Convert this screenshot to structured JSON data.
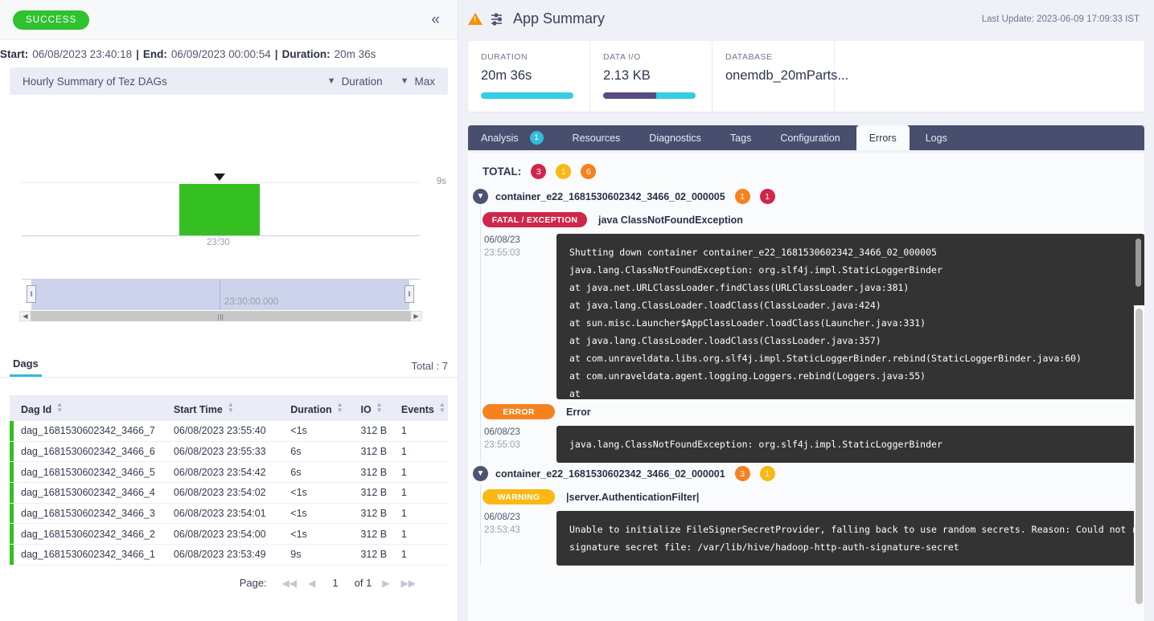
{
  "left": {
    "status": "SUCCESS",
    "collapse_icon": "double-chevron-left-icon",
    "times": {
      "start_label": "Start:",
      "start_value": "06/08/2023 23:40:18",
      "end_label": "End:",
      "end_value": "06/09/2023 00:00:54",
      "duration_label": "Duration:",
      "duration_value": "20m 36s"
    },
    "chart_header": {
      "title": "Hourly Summary of Tez DAGs",
      "metric": "Duration",
      "aggregation": "Max"
    },
    "brush": {
      "center_label": "23:30:00.000"
    },
    "dags": {
      "tab_label": "Dags",
      "total_label": "Total : 7",
      "columns": [
        "Dag Id",
        "Start Time",
        "Duration",
        "IO",
        "Events"
      ],
      "rows": [
        {
          "dag_id": "dag_1681530602342_3466_7",
          "start_time": "06/08/2023 23:55:40",
          "duration": "<1s",
          "io": "312 B",
          "events": "1",
          "status_color": "#35c022"
        },
        {
          "dag_id": "dag_1681530602342_3466_6",
          "start_time": "06/08/2023 23:55:33",
          "duration": "6s",
          "io": "312 B",
          "events": "1",
          "status_color": "#35c022"
        },
        {
          "dag_id": "dag_1681530602342_3466_5",
          "start_time": "06/08/2023 23:54:42",
          "duration": "6s",
          "io": "312 B",
          "events": "1",
          "status_color": "#35c022"
        },
        {
          "dag_id": "dag_1681530602342_3466_4",
          "start_time": "06/08/2023 23:54:02",
          "duration": "<1s",
          "io": "312 B",
          "events": "1",
          "status_color": "#35c022"
        },
        {
          "dag_id": "dag_1681530602342_3466_3",
          "start_time": "06/08/2023 23:54:01",
          "duration": "<1s",
          "io": "312 B",
          "events": "1",
          "status_color": "#35c022"
        },
        {
          "dag_id": "dag_1681530602342_3466_2",
          "start_time": "06/08/2023 23:54:00",
          "duration": "<1s",
          "io": "312 B",
          "events": "1",
          "status_color": "#35c022"
        },
        {
          "dag_id": "dag_1681530602342_3466_1",
          "start_time": "06/08/2023 23:53:49",
          "duration": "9s",
          "io": "312 B",
          "events": "1",
          "status_color": "#35c022"
        }
      ],
      "pager": {
        "label": "Page:",
        "current": "1",
        "of": "of 1"
      }
    }
  },
  "chart_data": {
    "type": "bar",
    "title": "Hourly Summary of Tez DAGs",
    "categories": [
      "23:30"
    ],
    "values": [
      9
    ],
    "xlabel": "",
    "ylabel": "",
    "ytick_labels": [
      "9s"
    ],
    "ylim": [
      0,
      9
    ],
    "bar_color": "#35c022",
    "grid": true,
    "legend": "none",
    "annotations": [
      {
        "type": "marker",
        "label": "selected-bucket",
        "x": "23:30"
      }
    ],
    "brush_label": "23:30:00.000"
  },
  "right": {
    "header": {
      "warning_icon": "warning-triangle-icon",
      "filter_icon": "sliders-icon",
      "title": "App Summary",
      "last_update": "Last Update: 2023-06-09 17:09:33 IST"
    },
    "kpis": [
      {
        "label": "DURATION",
        "value": "20m 36s",
        "bar": [
          {
            "color": "#34cde3",
            "pct": 100
          }
        ]
      },
      {
        "label": "DATA I/O",
        "value": "2.13 KB",
        "bar": [
          {
            "color": "#5b4b7e",
            "pct": 57
          },
          {
            "color": "#34cde3",
            "pct": 43
          }
        ]
      },
      {
        "label": "DATABASE",
        "value": "onemdb_20mParts...",
        "bar": []
      }
    ],
    "tabs": [
      {
        "label": "Analysis",
        "badge": "1",
        "active": false
      },
      {
        "label": "Resources",
        "badge": null,
        "active": false
      },
      {
        "label": "Diagnostics",
        "badge": null,
        "active": false
      },
      {
        "label": "Tags",
        "badge": null,
        "active": false
      },
      {
        "label": "Configuration",
        "badge": null,
        "active": false
      },
      {
        "label": "Errors",
        "badge": null,
        "active": true
      },
      {
        "label": "Logs",
        "badge": null,
        "active": false
      }
    ],
    "errors": {
      "total_label": "TOTAL:",
      "total_badges": [
        {
          "count": "3",
          "color": "#d0264a"
        },
        {
          "count": "1",
          "color": "#fbb814"
        },
        {
          "count": "6",
          "color": "#f5821f"
        }
      ],
      "containers": [
        {
          "name": "container_e22_1681530602342_3466_02_000005",
          "badges": [
            {
              "count": "1",
              "color": "#f5821f"
            },
            {
              "count": "1",
              "color": "#d0264a"
            }
          ],
          "entries": [
            {
              "severity": "FATAL / EXCEPTION",
              "severity_color": "#d0264a",
              "title": "java ClassNotFoundException",
              "date": "06/08/23",
              "time": "23:55:03",
              "lines": [
                "Shutting down container container_e22_1681530602342_3466_02_000005",
                "java.lang.ClassNotFoundException: org.slf4j.impl.StaticLoggerBinder",
                "at java.net.URLClassLoader.findClass(URLClassLoader.java:381)",
                "at java.lang.ClassLoader.loadClass(ClassLoader.java:424)",
                "at sun.misc.Launcher$AppClassLoader.loadClass(Launcher.java:331)",
                "at java.lang.ClassLoader.loadClass(ClassLoader.java:357)",
                "at com.unraveldata.libs.org.slf4j.impl.StaticLoggerBinder.rebind(StaticLoggerBinder.java:60)",
                "at com.unraveldata.agent.logging.Loggers.rebind(Loggers.java:55)",
                "at"
              ]
            },
            {
              "severity": "ERROR",
              "severity_color": "#f5821f",
              "title": "Error",
              "date": "06/08/23",
              "time": "23:55:03",
              "lines": [
                "java.lang.ClassNotFoundException: org.slf4j.impl.StaticLoggerBinder"
              ]
            }
          ]
        },
        {
          "name": "container_e22_1681530602342_3466_02_000001",
          "badges": [
            {
              "count": "3",
              "color": "#f5821f"
            },
            {
              "count": "1",
              "color": "#fbb814"
            }
          ],
          "entries": [
            {
              "severity": "WARNING",
              "severity_color": "#fbb814",
              "title": "|server.AuthenticationFilter|",
              "date": "06/08/23",
              "time": "23:53:43",
              "lines": [
                "Unable to initialize FileSignerSecretProvider, falling back to use random secrets. Reason: Could not read",
                "signature secret file: /var/lib/hive/hadoop-http-auth-signature-secret"
              ]
            }
          ]
        }
      ]
    }
  }
}
